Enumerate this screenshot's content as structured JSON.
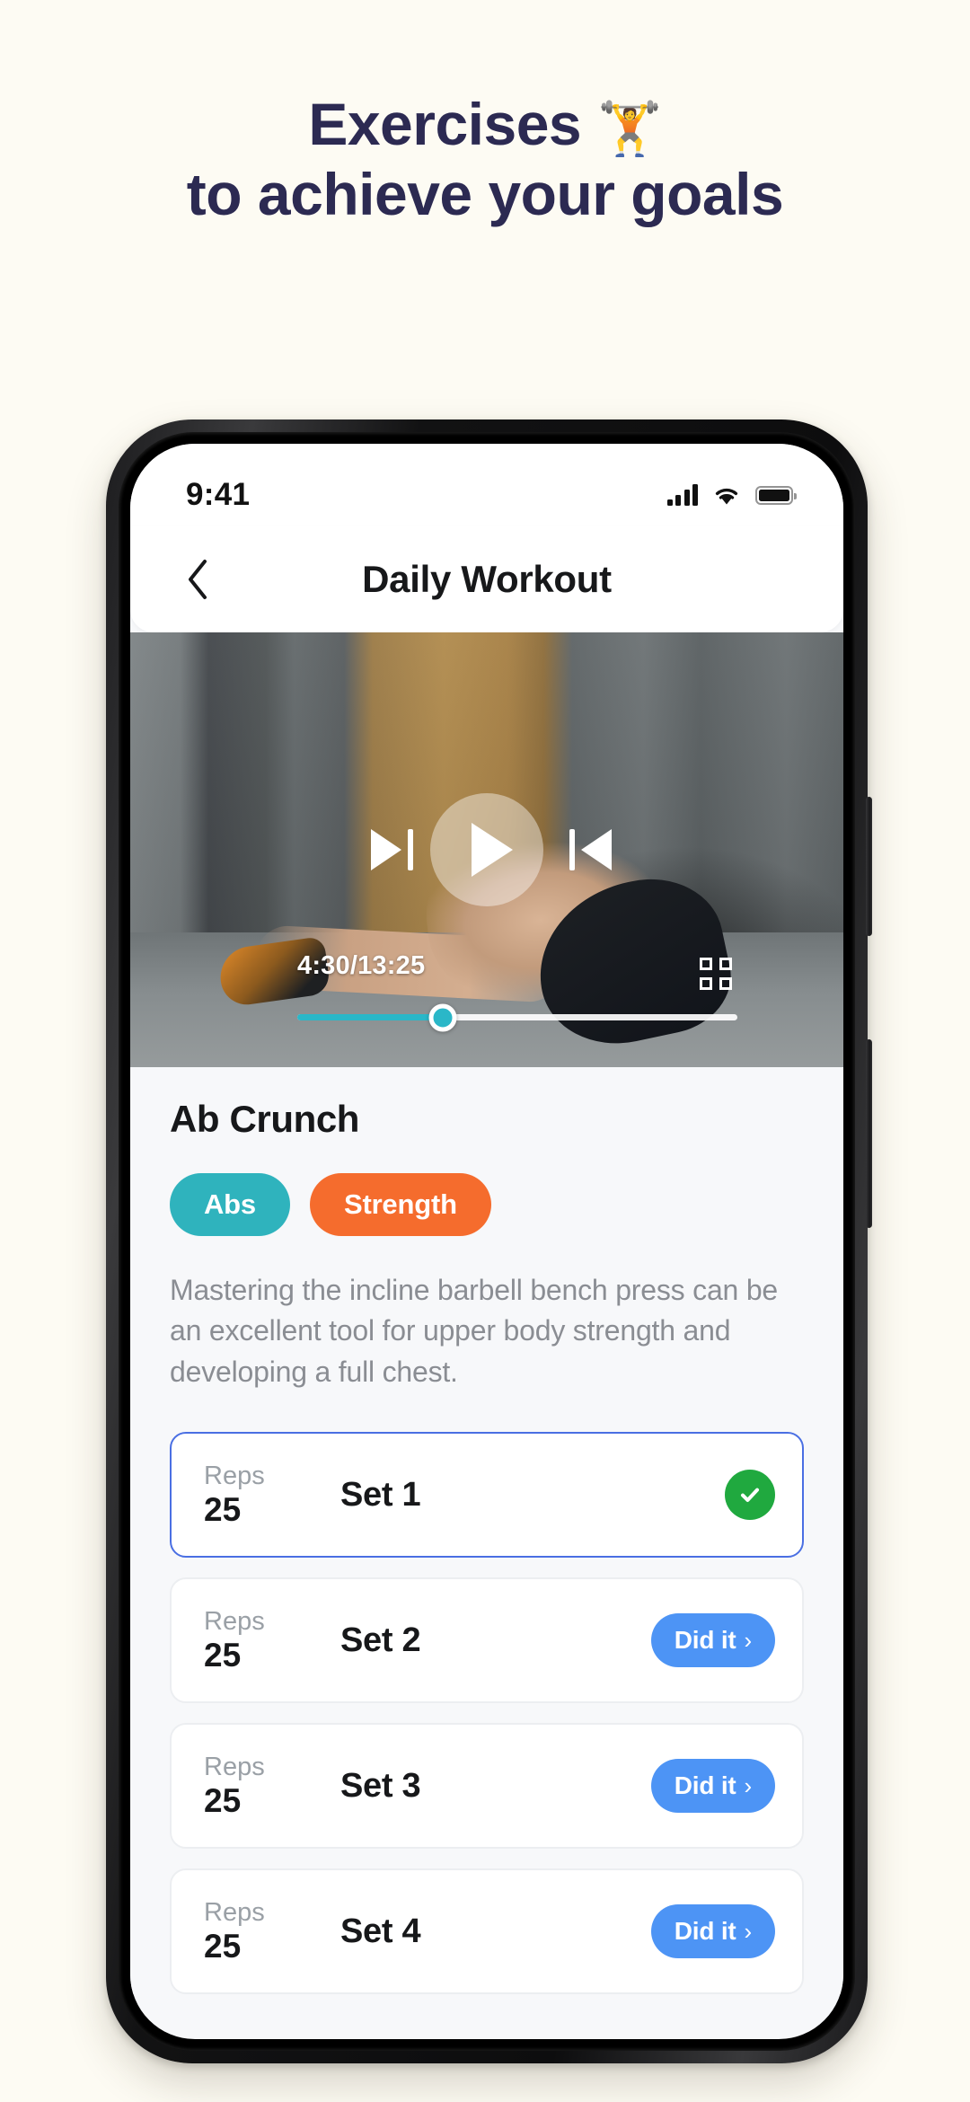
{
  "promo": {
    "headline_line1": "Exercises",
    "headline_emoji": "🏋️",
    "headline_line2": "to achieve your goals",
    "background_color": "#fdfbf3",
    "headline_color": "#2c2a52"
  },
  "status_bar": {
    "time": "9:41",
    "signal_icon": "signal-bars-icon",
    "wifi_icon": "wifi-icon",
    "battery_icon": "battery-full-icon"
  },
  "nav": {
    "back_icon": "chevron-left-icon",
    "title": "Daily Workout"
  },
  "video": {
    "play_icon": "play-icon",
    "skip_forward_icon": "skip-forward-icon",
    "skip_back_icon": "skip-back-icon",
    "fullscreen_icon": "fullscreen-icon",
    "timecode": "4:30/13:25",
    "current_time": "4:30",
    "duration": "13:25",
    "progress_percent": 33,
    "progress_color": "#2ab7c8"
  },
  "exercise": {
    "title": "Ab Crunch",
    "tags": [
      {
        "label": "Abs",
        "color": "#2fb3bd"
      },
      {
        "label": "Strength",
        "color": "#f56c2d"
      }
    ],
    "description": "Mastering the incline barbell bench press can be an excellent tool for upper body strength and developing a full chest."
  },
  "sets": {
    "reps_label": "Reps",
    "action_label": "Did it",
    "action_chevron": "›",
    "items": [
      {
        "name": "Set 1",
        "reps": "25",
        "state": "done",
        "active": true,
        "check_icon": "check-circle-icon"
      },
      {
        "name": "Set 2",
        "reps": "25",
        "state": "pending",
        "active": false
      },
      {
        "name": "Set 3",
        "reps": "25",
        "state": "pending",
        "active": false
      },
      {
        "name": "Set 4",
        "reps": "25",
        "state": "pending",
        "active": false
      }
    ]
  }
}
